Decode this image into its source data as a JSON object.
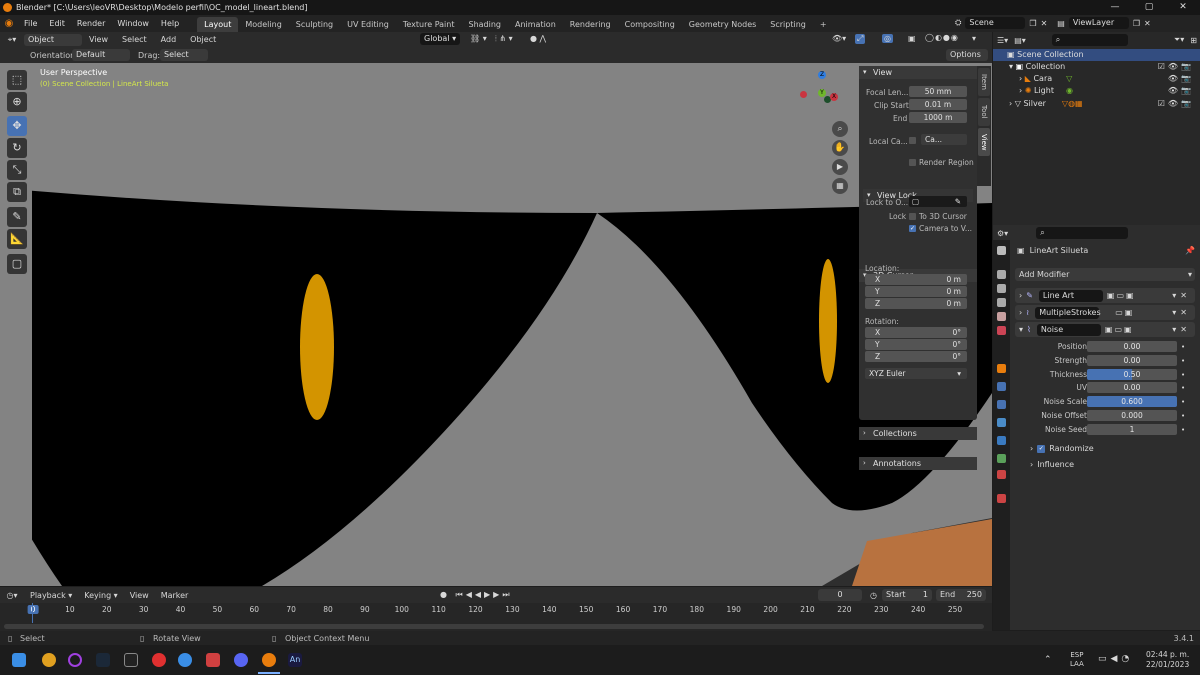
{
  "window": {
    "title": "Blender* [C:\\Users\\leoVR\\Desktop\\Modelo perfil\\OC_model_lineart.blend]",
    "minimize": "—",
    "maximize": "▢",
    "close": "✕"
  },
  "menu": [
    "File",
    "Edit",
    "Render",
    "Window",
    "Help"
  ],
  "workspaces": [
    "Layout",
    "Modeling",
    "Sculpting",
    "UV Editing",
    "Texture Paint",
    "Shading",
    "Animation",
    "Rendering",
    "Compositing",
    "Geometry Nodes",
    "Scripting"
  ],
  "workspace_add": "+",
  "scene": "Scene",
  "viewlayer": "ViewLayer",
  "viewport": {
    "mode": "Object Mode",
    "menus": [
      "View",
      "Select",
      "Add",
      "Object"
    ],
    "orientation_label": "Orientation:",
    "orientation": "Default",
    "drag_label": "Drag:",
    "drag": "Select Box",
    "transform": "Global",
    "options": "Options",
    "view_name": "User Perspective",
    "view_sub": "(0) Scene Collection | LineArt Silueta",
    "gizmo": {
      "x": "X",
      "y": "Y",
      "z": "Z"
    }
  },
  "npanel": {
    "view_header": "View",
    "focal_label": "Focal Len...",
    "focal": "50 mm",
    "clip_start_label": "Clip Start",
    "clip_start": "0.01 m",
    "end_label": "End",
    "end": "1000 m",
    "local_camera_label": "Local Ca...",
    "local_camera": "Ca...",
    "render_region": "Render Region",
    "view_lock_header": "View Lock",
    "lock_to_object_label": "Lock to O...",
    "lock_label": "Lock",
    "to_3d_cursor": "To 3D Cursor",
    "camera_to_view": "Camera to V...",
    "cursor_header": "3D Cursor",
    "location_label": "Location:",
    "loc": [
      {
        "axis": "X",
        "val": "0 m"
      },
      {
        "axis": "Y",
        "val": "0 m"
      },
      {
        "axis": "Z",
        "val": "0 m"
      }
    ],
    "rotation_label": "Rotation:",
    "rot": [
      {
        "axis": "X",
        "val": "0°"
      },
      {
        "axis": "Y",
        "val": "0°"
      },
      {
        "axis": "Z",
        "val": "0°"
      }
    ],
    "rotation_mode": "XYZ Euler",
    "collections": "Collections",
    "annotations": "Annotations",
    "tabs": [
      "Item",
      "Tool",
      "View"
    ]
  },
  "outliner": {
    "rows": [
      {
        "name": "Scene Collection"
      },
      {
        "name": "Collection"
      },
      {
        "name": "Cara"
      },
      {
        "name": "Light"
      },
      {
        "name": "Silver"
      }
    ]
  },
  "properties": {
    "object_name": "LineArt Silueta",
    "add_modifier": "Add Modifier",
    "modifiers": [
      "Line Art",
      "MultipleStrokes",
      "Noise"
    ],
    "noise_props": [
      {
        "label": "Position",
        "value": "0.00",
        "fill": 0
      },
      {
        "label": "Strength",
        "value": "0.00",
        "fill": 0
      },
      {
        "label": "Thickness",
        "value": "0.50",
        "fill": 0.5
      },
      {
        "label": "UV",
        "value": "0.00",
        "fill": 0
      },
      {
        "label": "Noise Scale",
        "value": "0.600",
        "fill": 1
      },
      {
        "label": "Noise Offset",
        "value": "0.000",
        "fill": 0
      },
      {
        "label": "Noise Seed",
        "value": "1",
        "fill": 0
      }
    ],
    "randomize": "Randomize",
    "influence": "Influence"
  },
  "timeline": {
    "menus": [
      "Playback",
      "Keying",
      "View",
      "Marker"
    ],
    "current_frame": "0",
    "start_label": "Start",
    "start": "1",
    "end_label": "End",
    "end": "250",
    "ticks": [
      "0",
      "10",
      "20",
      "30",
      "40",
      "50",
      "60",
      "70",
      "80",
      "90",
      "100",
      "110",
      "120",
      "130",
      "140",
      "150",
      "160",
      "170",
      "180",
      "190",
      "200",
      "210",
      "220",
      "230",
      "240",
      "250"
    ]
  },
  "status": {
    "select": "Select",
    "rotate": "Rotate View",
    "context": "Object Context Menu",
    "version": "3.4.1"
  },
  "taskbar": {
    "lang": "ESP",
    "lang2": "LAA",
    "time": "02:44 p. m.",
    "date": "22/01/2023",
    "apps": [
      "windows-icon",
      "chrome-icon",
      "circle-app-icon",
      "steam-icon",
      "epic-icon",
      "ea-icon",
      "store-icon",
      "image-app-icon",
      "discord-icon",
      "blender-icon",
      "animate-icon"
    ]
  },
  "colors": {
    "accent": "#4772b3",
    "eye": "#d39400",
    "floor": "#b8723f",
    "orange": "#e87d0d"
  }
}
